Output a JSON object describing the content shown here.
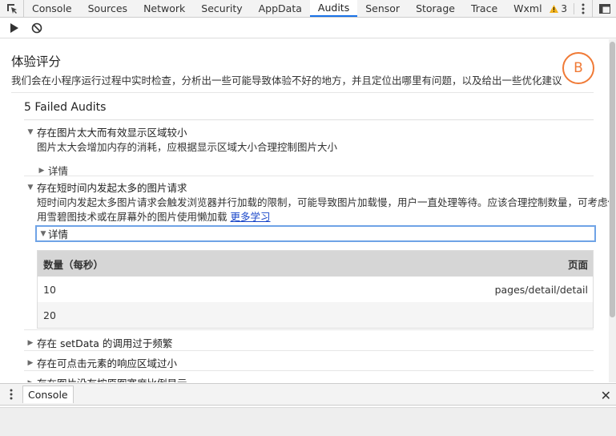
{
  "tabbar": {
    "tabs": [
      {
        "label": "Console"
      },
      {
        "label": "Sources"
      },
      {
        "label": "Network"
      },
      {
        "label": "Security"
      },
      {
        "label": "AppData"
      },
      {
        "label": "Audits",
        "active": true
      },
      {
        "label": "Sensor"
      },
      {
        "label": "Storage"
      },
      {
        "label": "Trace"
      },
      {
        "label": "Wxml"
      }
    ],
    "warning_count": "3"
  },
  "score": {
    "title": "体验评分",
    "description": "我们会在小程序运行过程中实时检查，分析出一些可能导致体验不好的地方，并且定位出哪里有问题，以及给出一些优化建议",
    "grade": "B",
    "grade_color": "#f07a36"
  },
  "failed": {
    "heading": "5 Failed Audits"
  },
  "audits": [
    {
      "title": "存在图片太大而有效显示区域较小",
      "description": "图片太大会增加内存的消耗，应根据显示区域大小合理控制图片大小",
      "detail_label": "详情"
    },
    {
      "title": "存在短时间内发起太多的图片请求",
      "description_line1": "短时间内发起太多图片请求会触发浏览器并行加载的限制，可能导致图片加载慢，用户一直处理等待。应该合理控制数量，可考虑使",
      "description_line2": "用雪碧图技术或在屏幕外的图片使用懒加载",
      "learn_more": "更多学习",
      "detail_label": "详情",
      "table": {
        "headers": [
          "数量（每秒）",
          "页面"
        ],
        "rows": [
          [
            "10",
            "pages/detail/detail"
          ],
          [
            "20",
            ""
          ]
        ]
      }
    },
    {
      "title": "存在 setData 的调用过于频繁"
    },
    {
      "title": "存在可点击元素的响应区域过小"
    },
    {
      "title": "存在图片没有按原图宽度比例显示"
    }
  ],
  "drawer": {
    "tab_label": "Console"
  }
}
